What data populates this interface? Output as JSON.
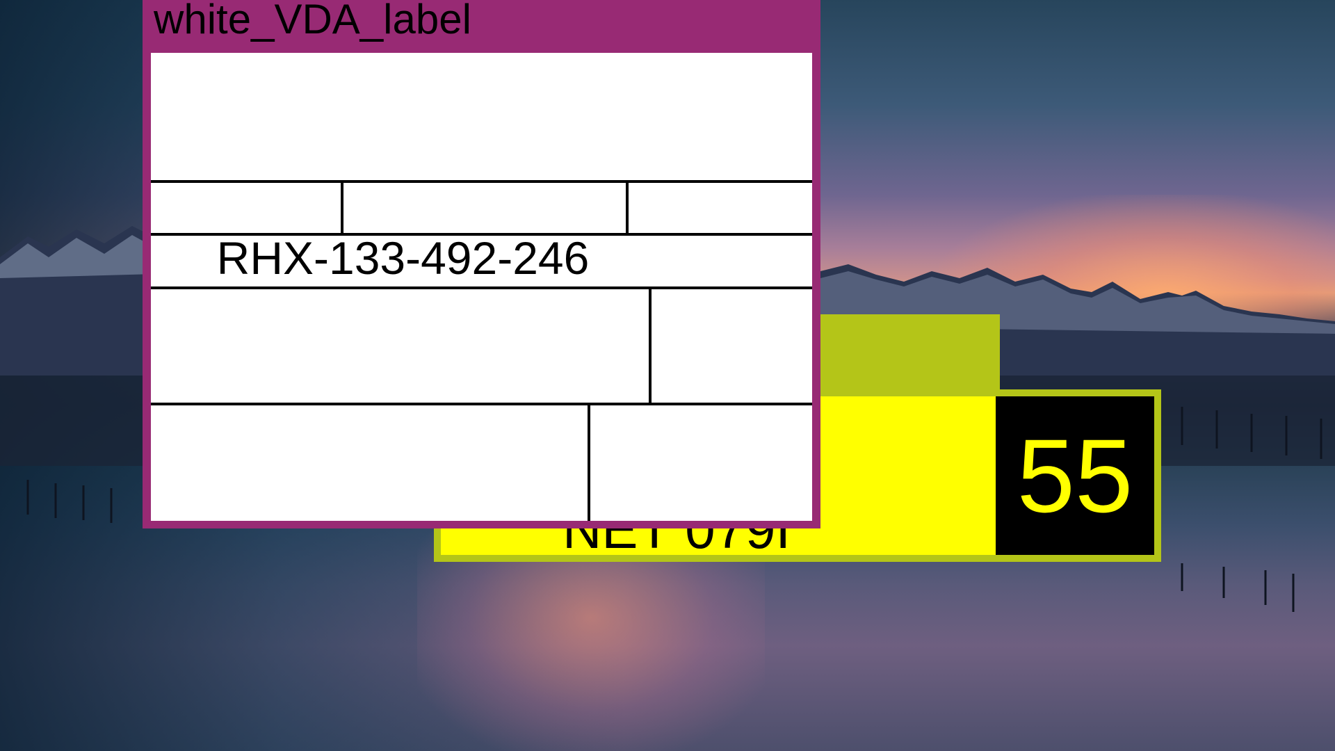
{
  "wallpaper": {
    "description_colors": {
      "sky_top": "#27455c",
      "sunset": "#e1a17c",
      "mountains": "#2b3550",
      "water": "#3c4f6d"
    }
  },
  "windows": {
    "vda_label": {
      "title": "white_VDA_label",
      "code": "RHX-133-492-246",
      "frame_color": "#982a74",
      "body_color": "#ffffff"
    },
    "yellow_plate": {
      "plate_text": "NET 079I",
      "number": "55",
      "frame_color": "#b4c518",
      "body_color": "#ffff00",
      "number_bg": "#000000",
      "number_color": "#ffff00"
    }
  }
}
